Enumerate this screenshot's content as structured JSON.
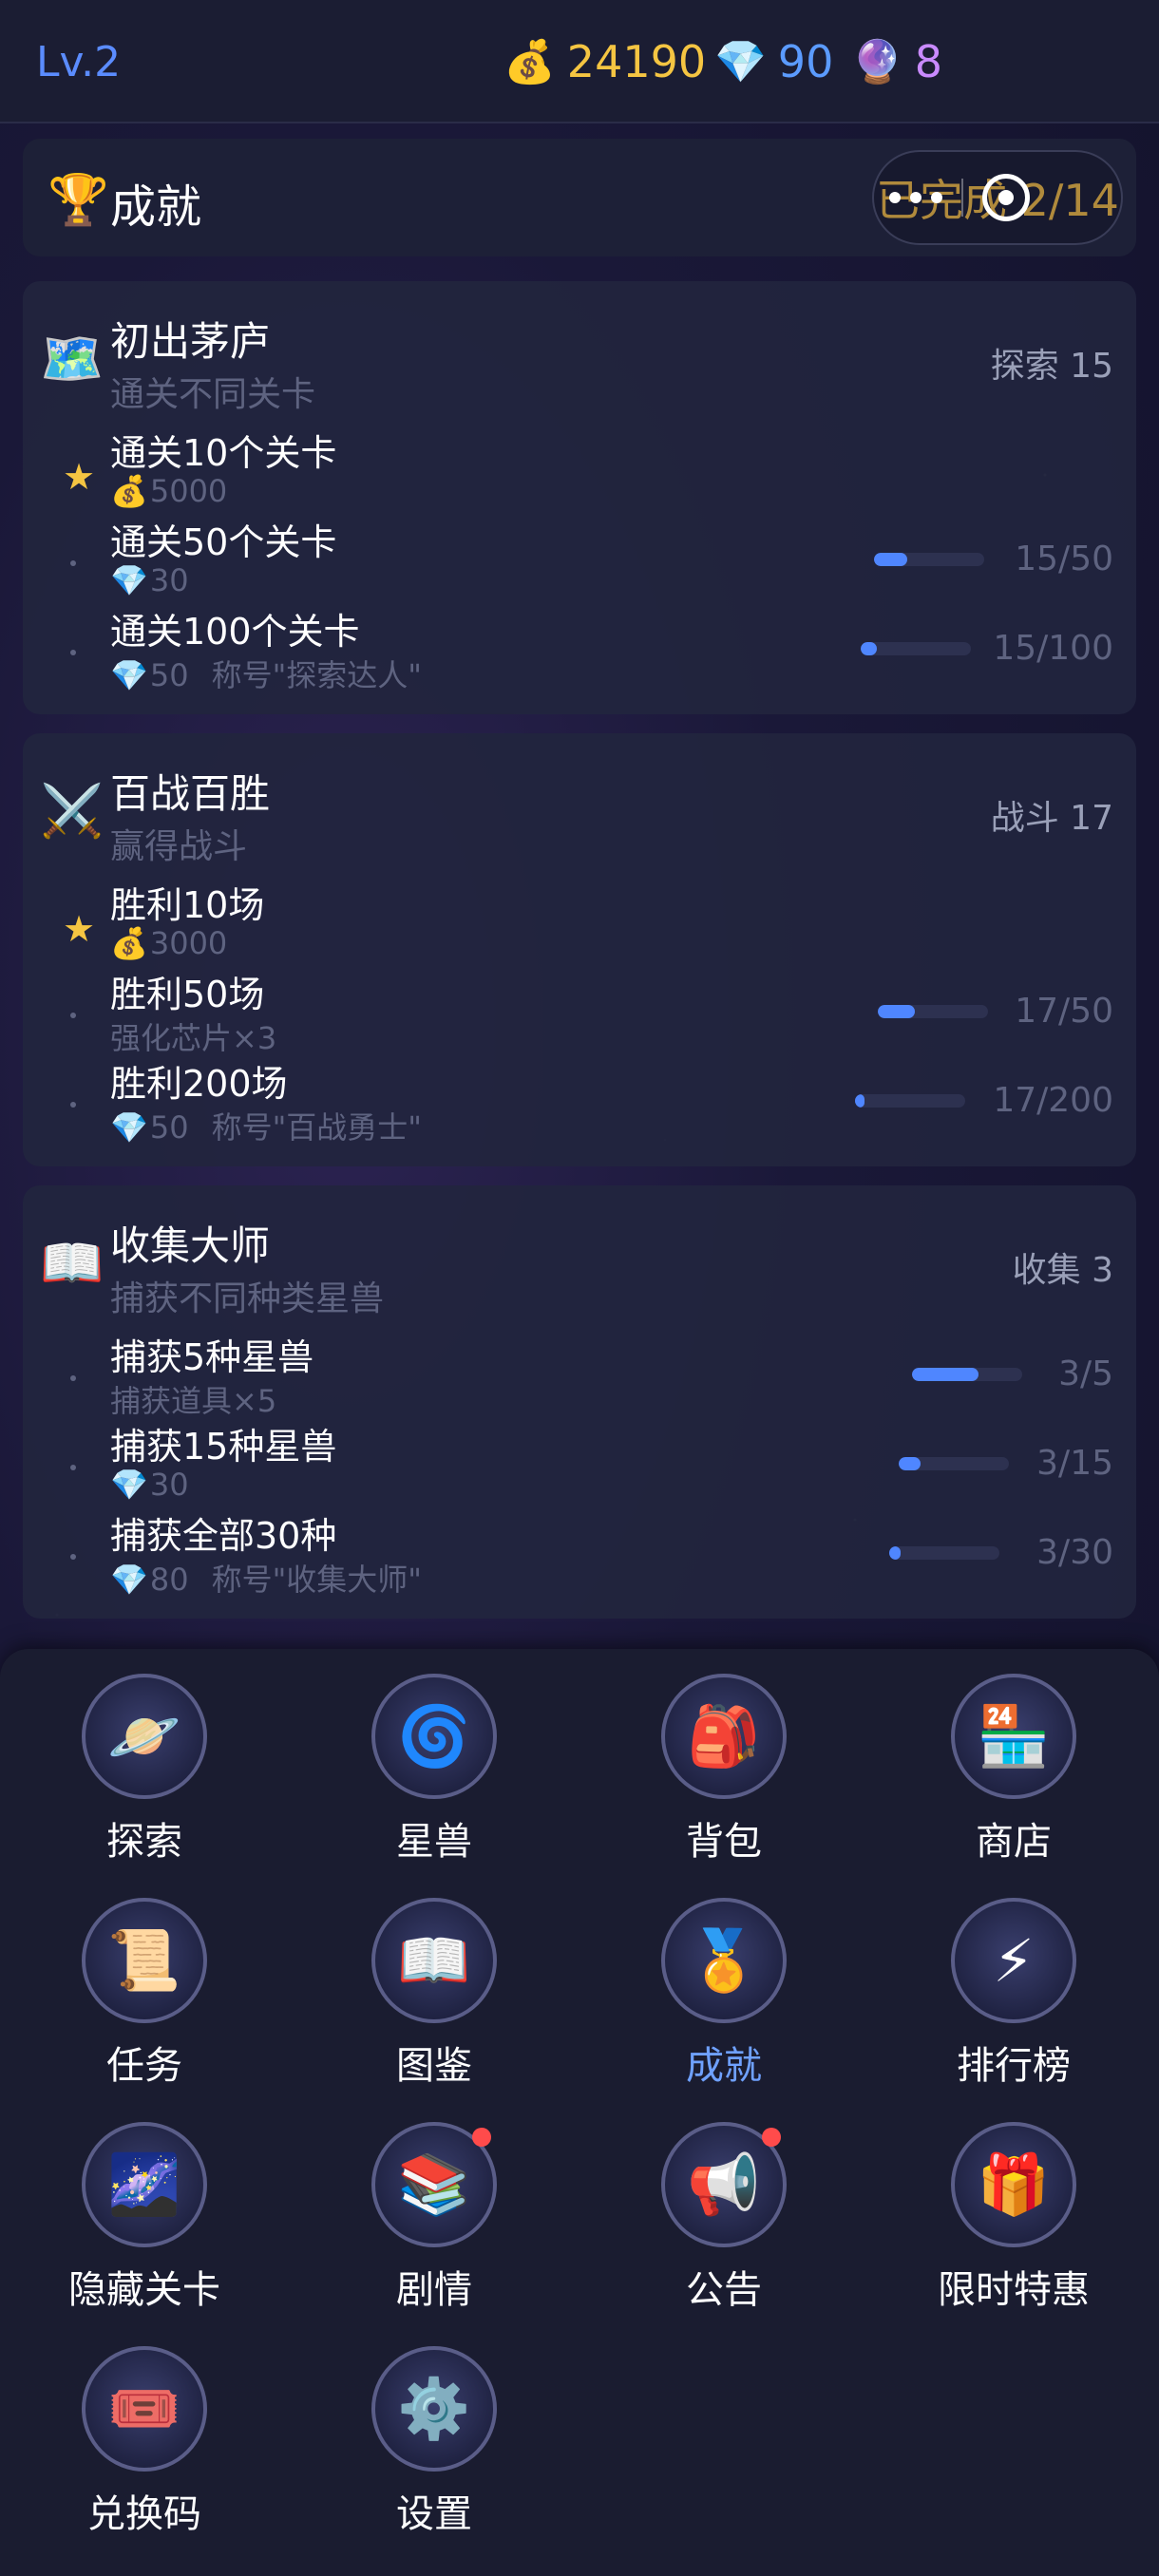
{
  "topbar": {
    "level": "Lv.2",
    "coins": "24190",
    "gems": "90",
    "orbs": "8",
    "coin_icon": "💰",
    "gem_icon": "💎",
    "orb_icon": "🔮"
  },
  "header": {
    "icon": "🏆",
    "title": "成就",
    "completed": "已完成 2/14"
  },
  "achievements": [
    {
      "icon": "🗺️",
      "title": "初出茅庐",
      "subtitle": "通关不同关卡",
      "category": "探索 15",
      "tiers": [
        {
          "name": "通关10个关卡",
          "reward_icon": "💰",
          "reward": "5000",
          "title_reward": "",
          "progress": "",
          "fill": 1.0,
          "done": true
        },
        {
          "name": "通关50个关卡",
          "reward_icon": "💎",
          "reward": "30",
          "title_reward": "",
          "progress": "15/50",
          "fill": 0.3,
          "done": false
        },
        {
          "name": "通关100个关卡",
          "reward_icon": "💎",
          "reward": "50",
          "title_reward": "称号\"探索达人\"",
          "progress": "15/100",
          "fill": 0.15,
          "done": false
        }
      ]
    },
    {
      "icon": "⚔️",
      "title": "百战百胜",
      "subtitle": "赢得战斗",
      "category": "战斗 17",
      "tiers": [
        {
          "name": "胜利10场",
          "reward_icon": "💰",
          "reward": "3000",
          "title_reward": "",
          "progress": "",
          "fill": 1.0,
          "done": true
        },
        {
          "name": "胜利50场",
          "reward_icon": "",
          "reward": "强化芯片×3",
          "title_reward": "",
          "progress": "17/50",
          "fill": 0.34,
          "done": false
        },
        {
          "name": "胜利200场",
          "reward_icon": "💎",
          "reward": "50",
          "title_reward": "称号\"百战勇士\"",
          "progress": "17/200",
          "fill": 0.085,
          "done": false
        }
      ]
    },
    {
      "icon": "📖",
      "title": "收集大师",
      "subtitle": "捕获不同种类星兽",
      "category": "收集 3",
      "tiers": [
        {
          "name": "捕获5种星兽",
          "reward_icon": "",
          "reward": "捕获道具×5",
          "title_reward": "",
          "progress": "3/5",
          "fill": 0.6,
          "done": false
        },
        {
          "name": "捕获15种星兽",
          "reward_icon": "💎",
          "reward": "30",
          "title_reward": "",
          "progress": "3/15",
          "fill": 0.2,
          "done": false
        },
        {
          "name": "捕获全部30种",
          "reward_icon": "💎",
          "reward": "80",
          "title_reward": "称号\"收集大师\"",
          "progress": "3/30",
          "fill": 0.1,
          "done": false
        }
      ]
    }
  ],
  "menu": [
    {
      "label": "探索",
      "icon": "🪐",
      "icon_name": "planet-icon",
      "badge": false,
      "active": false
    },
    {
      "label": "星兽",
      "icon": "🌀",
      "icon_name": "star-beast-icon",
      "badge": false,
      "active": false
    },
    {
      "label": "背包",
      "icon": "🎒",
      "icon_name": "backpack-icon",
      "badge": false,
      "active": false
    },
    {
      "label": "商店",
      "icon": "🏪",
      "icon_name": "shop-icon",
      "badge": false,
      "active": false
    },
    {
      "label": "任务",
      "icon": "📜",
      "icon_name": "scroll-icon",
      "badge": false,
      "active": false
    },
    {
      "label": "图鉴",
      "icon": "📖",
      "icon_name": "book-icon",
      "badge": false,
      "active": false
    },
    {
      "label": "成就",
      "icon": "🏅",
      "icon_name": "achievement-icon",
      "badge": false,
      "active": true
    },
    {
      "label": "排行榜",
      "icon": "⚡",
      "icon_name": "leaderboard-icon",
      "badge": false,
      "active": false
    },
    {
      "label": "隐藏关卡",
      "icon": "🌌",
      "icon_name": "vortex-icon",
      "badge": false,
      "active": false
    },
    {
      "label": "剧情",
      "icon": "📚",
      "icon_name": "story-book-icon",
      "badge": true,
      "active": false
    },
    {
      "label": "公告",
      "icon": "📢",
      "icon_name": "megaphone-icon",
      "badge": true,
      "active": false
    },
    {
      "label": "限时特惠",
      "icon": "🎁",
      "icon_name": "gift-icon",
      "badge": false,
      "active": false
    },
    {
      "label": "兑换码",
      "icon": "🎟️",
      "icon_name": "ticket-icon",
      "badge": false,
      "active": false
    },
    {
      "label": "设置",
      "icon": "⚙️",
      "icon_name": "gear-icon",
      "badge": false,
      "active": false
    }
  ]
}
